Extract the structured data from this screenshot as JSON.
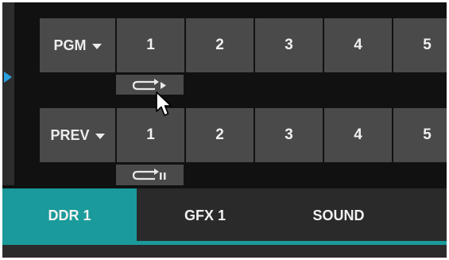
{
  "switcher": {
    "pgm": {
      "label": "PGM",
      "sources": [
        "1",
        "2",
        "3",
        "4",
        "5"
      ],
      "loop_control": {
        "icon": "loop-play-icon"
      }
    },
    "prev": {
      "label": "PREV",
      "sources": [
        "1",
        "2",
        "3",
        "4",
        "5"
      ],
      "loop_control": {
        "icon": "loop-pause-icon"
      }
    }
  },
  "tabs": [
    {
      "label": "DDR 1",
      "active": true
    },
    {
      "label": "GFX 1",
      "active": false
    },
    {
      "label": "SOUND",
      "active": false
    }
  ],
  "colors": {
    "accent": "#1a9a9a",
    "marker": "#2aa0e0",
    "button": "#4a4a4a",
    "background": "#111111"
  }
}
